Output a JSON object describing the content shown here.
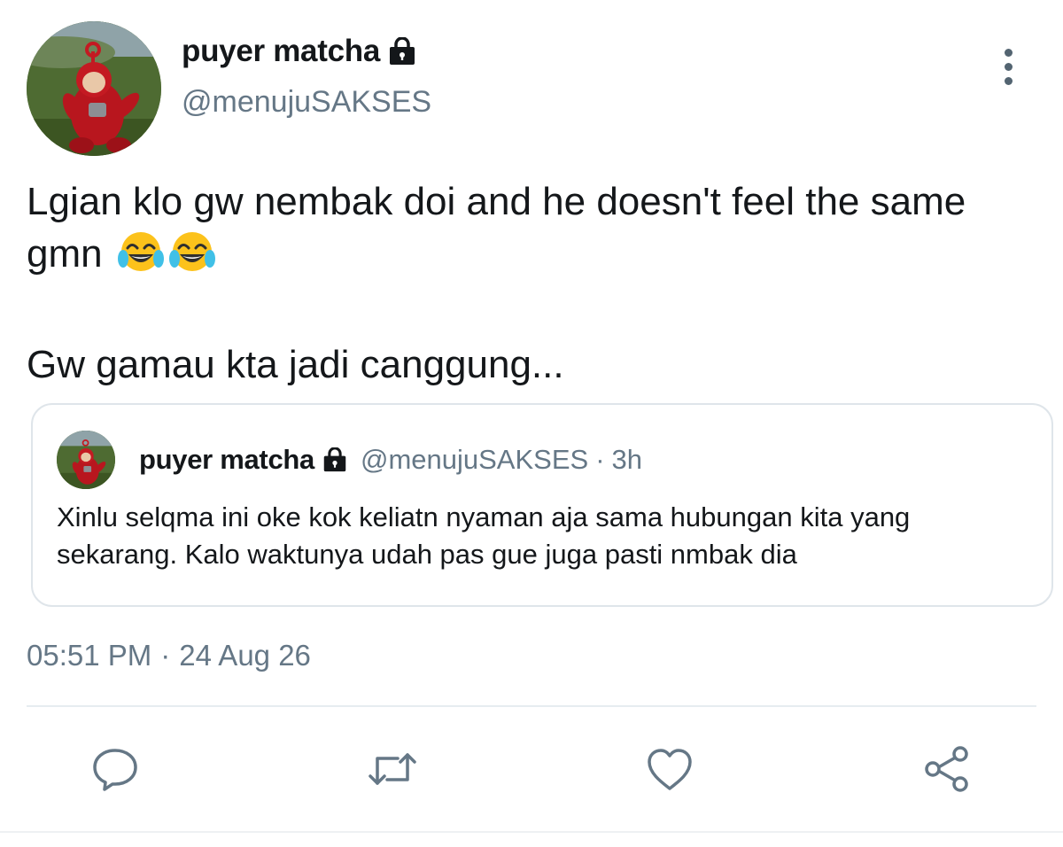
{
  "tweet": {
    "display_name": "puyer matcha",
    "handle": "@menujuSAKSES",
    "protected_icon": "lock-icon",
    "more_icon": "more-vertical-icon",
    "text_line1": "Lgian klo gw nembak doi and he doesn't feel the same",
    "text_line2_prefix": "gmn",
    "text_line2_emoji": "😂😂",
    "text_line3": "Gw gamau kta jadi canggung...",
    "timestamp_time": "05:51 PM",
    "timestamp_separator": "·",
    "timestamp_date": "24 Aug 26"
  },
  "quoted_tweet": {
    "display_name": "puyer matcha",
    "handle": "@menujuSAKSES",
    "separator": "·",
    "time_ago": "3h",
    "text": "Xinlu selqma ini oke kok keliatn nyaman aja sama hubungan kita yang sekarang. Kalo waktunya udah pas gue juga pasti nmbak dia"
  },
  "actions": {
    "reply_icon": "reply-icon",
    "retweet_icon": "retweet-icon",
    "like_icon": "heart-icon",
    "share_icon": "share-icon"
  },
  "colors": {
    "text_primary": "#14171a",
    "text_secondary": "#657786",
    "icon": "#657786",
    "border": "#dfe5ea"
  }
}
